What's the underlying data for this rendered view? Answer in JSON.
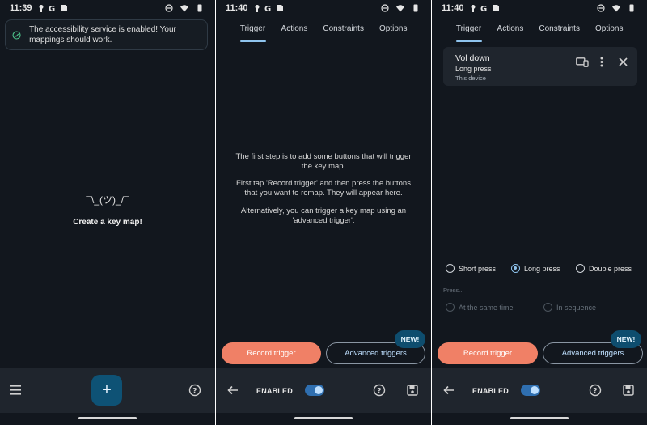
{
  "screens": [
    {
      "status": {
        "time": "11:39"
      },
      "banner": {
        "message": "The accessibility service is enabled! Your mappings should work."
      },
      "empty": {
        "shrug": "¯\\_(ツ)_/¯",
        "title": "Create a key map!"
      },
      "fab": {
        "label": "+"
      }
    },
    {
      "status": {
        "time": "11:40"
      },
      "tabs": [
        "Trigger",
        "Actions",
        "Constraints",
        "Options"
      ],
      "info": {
        "p1": "The first step is to add some buttons that will trigger the key map.",
        "p2": "First tap 'Record trigger' and then press the buttons that you want to remap. They will appear here.",
        "p3": "Alternatively, you can trigger a key map using an 'advanced trigger'."
      },
      "buttons": {
        "record": "Record trigger",
        "advanced": "Advanced triggers",
        "badge": "NEW!"
      },
      "bottom": {
        "enabled": "ENABLED",
        "enabled_on": true
      }
    },
    {
      "status": {
        "time": "11:40"
      },
      "tabs": [
        "Trigger",
        "Actions",
        "Constraints",
        "Options"
      ],
      "trigger_card": {
        "name": "Vol down",
        "type": "Long press",
        "device": "This device"
      },
      "press_options": [
        "Short press",
        "Long press",
        "Double press"
      ],
      "press_selected": "Long press",
      "press_label": "Press...",
      "sequence_options": [
        "At the same time",
        "In sequence"
      ],
      "buttons": {
        "record": "Record trigger",
        "advanced": "Advanced triggers",
        "badge": "NEW!"
      },
      "bottom": {
        "enabled": "ENABLED",
        "enabled_on": true
      }
    }
  ],
  "colors": {
    "background": "#12171e",
    "accent": "#8fc4ee",
    "record": "#f08066",
    "badge": "#0e4d6e",
    "fab": "#0e5275",
    "success": "#4cc38a"
  }
}
